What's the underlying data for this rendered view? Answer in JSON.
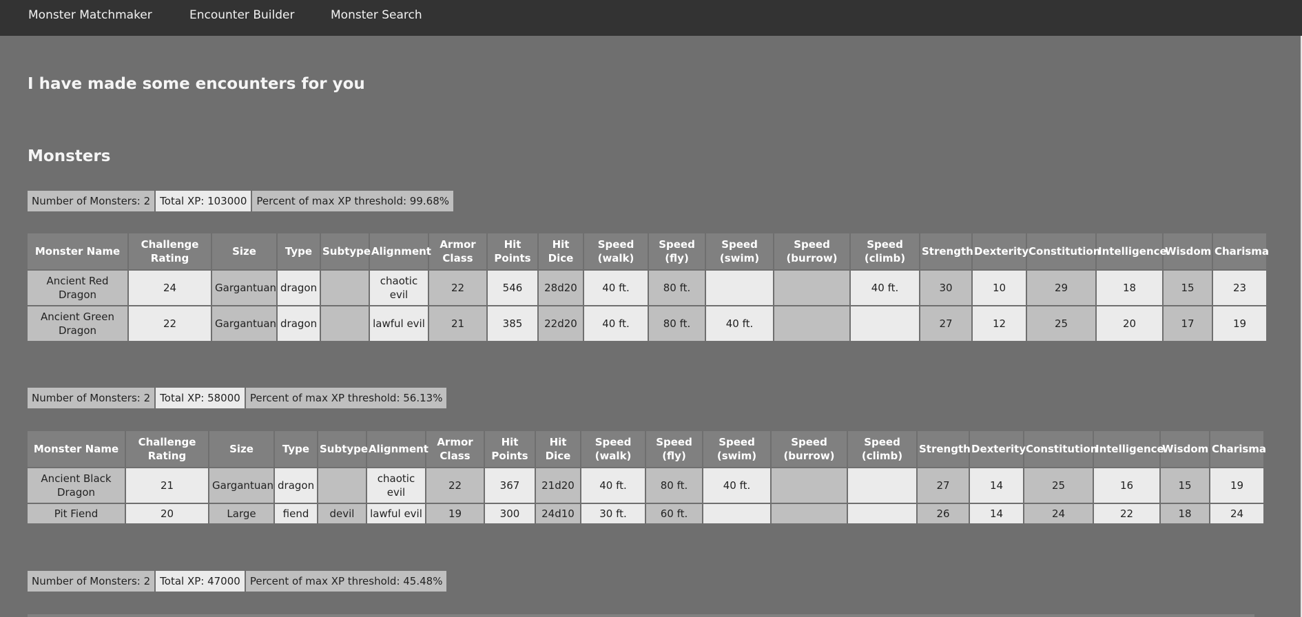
{
  "nav": {
    "items": [
      "Monster Matchmaker",
      "Encounter Builder",
      "Monster Search"
    ]
  },
  "page": {
    "heading": "I have made some encounters for you",
    "section_title": "Monsters"
  },
  "columns": [
    "Monster Name",
    "Challenge Rating",
    "Size",
    "Type",
    "Subtype",
    "Alignment",
    "Armor Class",
    "Hit Points",
    "Hit Dice",
    "Speed (walk)",
    "Speed (fly)",
    "Speed (swim)",
    "Speed (burrow)",
    "Speed (climb)",
    "Strength",
    "Dexterity",
    "Constitution",
    "Intelligence",
    "Wisdom",
    "Charisma"
  ],
  "encounters": [
    {
      "summary": {
        "count": "Number of Monsters: 2",
        "xp": "Total XP: 103000",
        "percent": "Percent of max XP threshold: 99.68%"
      },
      "rows": [
        [
          "Ancient Red Dragon",
          "24",
          "Gargantuan",
          "dragon",
          "",
          "chaotic evil",
          "22",
          "546",
          "28d20",
          "40 ft.",
          "80 ft.",
          "",
          "",
          "40 ft.",
          "30",
          "10",
          "29",
          "18",
          "15",
          "23"
        ],
        [
          "Ancient Green Dragon",
          "22",
          "Gargantuan",
          "dragon",
          "",
          "lawful evil",
          "21",
          "385",
          "22d20",
          "40 ft.",
          "80 ft.",
          "40 ft.",
          "",
          "",
          "27",
          "12",
          "25",
          "20",
          "17",
          "19"
        ]
      ]
    },
    {
      "summary": {
        "count": "Number of Monsters: 2",
        "xp": "Total XP: 58000",
        "percent": "Percent of max XP threshold: 56.13%"
      },
      "rows": [
        [
          "Ancient Black Dragon",
          "21",
          "Gargantuan",
          "dragon",
          "",
          "chaotic evil",
          "22",
          "367",
          "21d20",
          "40 ft.",
          "80 ft.",
          "40 ft.",
          "",
          "",
          "27",
          "14",
          "25",
          "16",
          "15",
          "19"
        ],
        [
          "Pit Fiend",
          "20",
          "Large",
          "fiend",
          "devil",
          "lawful evil",
          "19",
          "300",
          "24d10",
          "30 ft.",
          "60 ft.",
          "",
          "",
          "",
          "26",
          "14",
          "24",
          "22",
          "18",
          "24"
        ]
      ]
    },
    {
      "summary": {
        "count": "Number of Monsters: 2",
        "xp": "Total XP: 47000",
        "percent": "Percent of max XP threshold: 45.48%"
      },
      "rows": []
    }
  ],
  "colors": {
    "background": "#6f6f6f",
    "topbar": "#333333",
    "header_cell": "#808080",
    "cell_dark": "#bfbfbf",
    "cell_light": "#ebebeb"
  }
}
